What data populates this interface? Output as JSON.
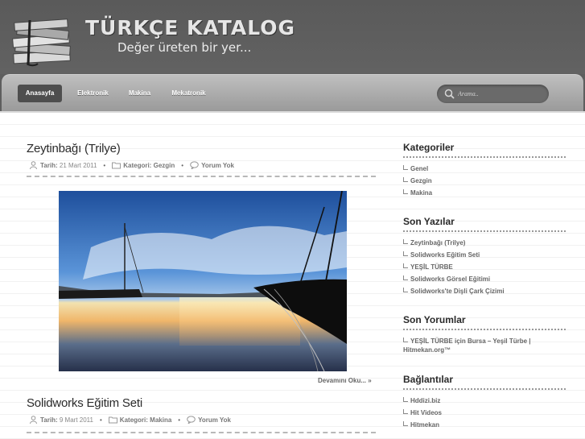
{
  "header": {
    "title": "TÜRKÇE KATALOG",
    "tagline": "Değer üreten bir yer..."
  },
  "nav": {
    "items": [
      {
        "label": "Anasayfa",
        "active": true
      },
      {
        "label": "Elektronik",
        "active": false
      },
      {
        "label": "Makina",
        "active": false
      },
      {
        "label": "Mekatronik",
        "active": false
      }
    ]
  },
  "search": {
    "placeholder": "Arama.."
  },
  "posts": [
    {
      "title": "Zeytinbağı (Trilye)",
      "date_label": "Tarih:",
      "date": "21 Mart 2011",
      "category_label": "Kategori:",
      "category": "Gezgin",
      "comments": "Yorum Yok",
      "read_more": "Devamını Oku... »"
    },
    {
      "title": "Solidworks Eğitim Seti",
      "date_label": "Tarih:",
      "date": "9 Mart 2011",
      "category_label": "Kategori:",
      "category": "Makina",
      "comments": "Yorum Yok"
    }
  ],
  "sidebar": {
    "categories": {
      "title": "Kategoriler",
      "items": [
        "Genel",
        "Gezgin",
        "Makina"
      ]
    },
    "recent_posts": {
      "title": "Son Yazılar",
      "items": [
        "Zeytinbağı (Trilye)",
        "Solidworks Eğitim Seti",
        "YEŞİL TÜRBE",
        "Solidworks Görsel Eğitimi",
        "Solidworks'te Dişli Çark Çizimi"
      ]
    },
    "recent_comments": {
      "title": "Son Yorumlar",
      "items": [
        "YEŞİL TÜRBE için Bursa – Yeşil Türbe | Hitmekan.org™"
      ]
    },
    "links": {
      "title": "Bağlantılar",
      "items": [
        "Hddizi.biz",
        "Hit Videos",
        "Hitmekan"
      ]
    }
  },
  "colors": {
    "header_bg": "#5e5e5e",
    "nav_active_bg": "#4e4e4e",
    "title_text": "#2b2b2b",
    "meta_text": "#888888"
  }
}
